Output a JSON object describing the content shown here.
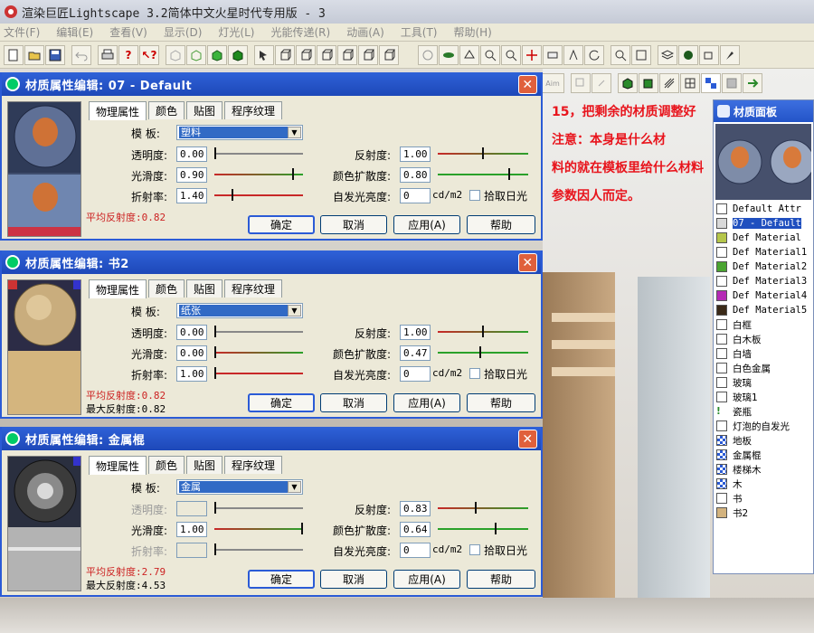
{
  "app": {
    "title": "渲染巨匠Lightscape 3.2简体中文火星时代专用版 - 3"
  },
  "menu": [
    "文件(F)",
    "编辑(E)",
    "查看(V)",
    "显示(D)",
    "灯光(L)",
    "光能传递(R)",
    "动画(A)",
    "工具(T)",
    "帮助(H)"
  ],
  "toolbar": {
    "icons": [
      "new-icon",
      "open-icon",
      "save-icon",
      "undo-icon",
      "print-icon",
      "help-icon",
      "context-help-icon"
    ]
  },
  "annotation": {
    "line1": "15，把剩余的材质调整好",
    "line2": "注意：本身是什么材",
    "line3": "料的就在模板里给什么材料",
    "line4": "参数因人而定。"
  },
  "panel": {
    "title": "材质面板",
    "items": [
      {
        "label": "Default Attr",
        "color": "#ffffff",
        "mono": true,
        "icon": "none",
        "selected": false
      },
      {
        "label": "07 - Default",
        "color": "#d9d9d9",
        "mono": true,
        "icon": "none",
        "selected": true
      },
      {
        "label": "Def Material",
        "color": "#b5c64b",
        "mono": true,
        "icon": "none",
        "selected": false
      },
      {
        "label": "Def Material1",
        "color": "#ffffff",
        "mono": true,
        "icon": "none",
        "selected": false
      },
      {
        "label": "Def Material2",
        "color": "#4aa431",
        "mono": true,
        "icon": "none",
        "selected": false
      },
      {
        "label": "Def Material3",
        "color": "#ffffff",
        "mono": true,
        "icon": "none",
        "selected": false
      },
      {
        "label": "Def Material4",
        "color": "#b52ab5",
        "mono": true,
        "icon": "none",
        "selected": false
      },
      {
        "label": "Def Material5",
        "color": "#3b2a18",
        "mono": true,
        "icon": "none",
        "selected": false
      },
      {
        "label": "白框",
        "color": "#ffffff",
        "mono": false,
        "icon": "none",
        "selected": false
      },
      {
        "label": "白木板",
        "color": "#ffffff",
        "mono": false,
        "icon": "none",
        "selected": false
      },
      {
        "label": "白墙",
        "color": "#ffffff",
        "mono": false,
        "icon": "none",
        "selected": false
      },
      {
        "label": "白色金属",
        "color": "#ffffff",
        "mono": false,
        "icon": "none",
        "selected": false
      },
      {
        "label": "玻璃",
        "color": "#ffffff",
        "mono": false,
        "icon": "none",
        "selected": false
      },
      {
        "label": "玻璃1",
        "color": "#ffffff",
        "mono": false,
        "icon": "none",
        "selected": false
      },
      {
        "label": "瓷瓶",
        "color": "#ffffff",
        "mono": false,
        "icon": "warning-icon",
        "selected": false
      },
      {
        "label": "灯泡的自发光",
        "color": "#ffffff",
        "mono": false,
        "icon": "none",
        "selected": false
      },
      {
        "label": "地板",
        "color": "#2b5bd6",
        "mono": false,
        "icon": "texture-icon",
        "selected": false
      },
      {
        "label": "金属棍",
        "color": "#2b5bd6",
        "mono": false,
        "icon": "texture-icon",
        "selected": false
      },
      {
        "label": "楼梯木",
        "color": "#2b5bd6",
        "mono": false,
        "icon": "texture-icon",
        "selected": false
      },
      {
        "label": "木",
        "color": "#2b5bd6",
        "mono": false,
        "icon": "texture-icon",
        "selected": false
      },
      {
        "label": "书",
        "color": "#ffffff",
        "mono": false,
        "icon": "none",
        "selected": false
      },
      {
        "label": "书2",
        "color": "#d3b37e",
        "mono": false,
        "icon": "none",
        "selected": false
      }
    ]
  },
  "common": {
    "tabs": [
      "物理属性",
      "颜色",
      "贴图",
      "程序纹理"
    ],
    "template_label": "模  板:",
    "transparency_label": "透明度:",
    "smoothness_label": "光滑度:",
    "refraction_label": "折射率:",
    "reflectance_label": "反射度:",
    "color_bleed_label": "颜色扩散度:",
    "luminance_label": "自发光亮度:",
    "unit": "cd/m2",
    "daylight_label": "拾取日光",
    "ok": "确定",
    "cancel": "取消",
    "apply": "应用(A)",
    "help": "帮助"
  },
  "dialogs": [
    {
      "title": "材质属性编辑: 07 - Default",
      "template": "塑料",
      "transparency": "0.00",
      "smoothness": "0.90",
      "refraction": "1.40",
      "reflectance": "1.00",
      "color_bleed": "0.80",
      "luminance": "0",
      "avg_reflectance": "平均反射度:0.82",
      "max_reflectance": ""
    },
    {
      "title": "材质属性编辑: 书2",
      "template": "纸张",
      "transparency": "0.00",
      "smoothness": "0.00",
      "refraction": "1.00",
      "reflectance": "1.00",
      "color_bleed": "0.47",
      "luminance": "0",
      "avg_reflectance": "平均反射度:0.82",
      "max_reflectance": "最大反射度:0.82"
    },
    {
      "title": "材质属性编辑: 金属棍",
      "template": "金属",
      "transparency": "",
      "smoothness": "1.00",
      "refraction": "",
      "reflectance": "0.83",
      "color_bleed": "0.64",
      "luminance": "0",
      "avg_reflectance": "平均反射度:2.79",
      "max_reflectance": "最大反射度:4.53"
    }
  ]
}
